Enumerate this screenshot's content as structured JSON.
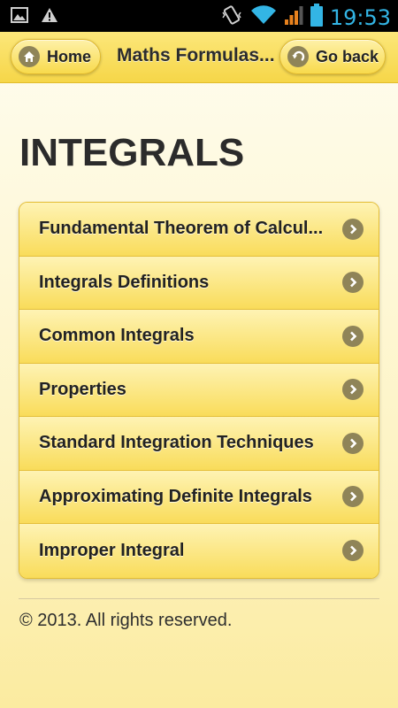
{
  "status_bar": {
    "time": "19:53",
    "icons": [
      "image-notification-icon",
      "warning-icon",
      "vibrate-icon",
      "wifi-icon",
      "signal-icon",
      "battery-icon"
    ]
  },
  "header": {
    "home_label": "Home",
    "title": "Maths Formulas...",
    "back_label": "Go back"
  },
  "page": {
    "title": "INTEGRALS"
  },
  "menu": {
    "items": [
      {
        "label": "Fundamental Theorem of Calcul..."
      },
      {
        "label": "Integrals Definitions"
      },
      {
        "label": "Common Integrals"
      },
      {
        "label": "Properties"
      },
      {
        "label": "Standard Integration Techniques"
      },
      {
        "label": "Approximating Definite Integrals"
      },
      {
        "label": "Improper Integral"
      }
    ]
  },
  "footer": {
    "text": "© 2013. All rights reserved."
  },
  "colors": {
    "status_accent": "#33b5e5",
    "header_yellow": "#f6d648",
    "icon_circle": "#8f8458"
  }
}
